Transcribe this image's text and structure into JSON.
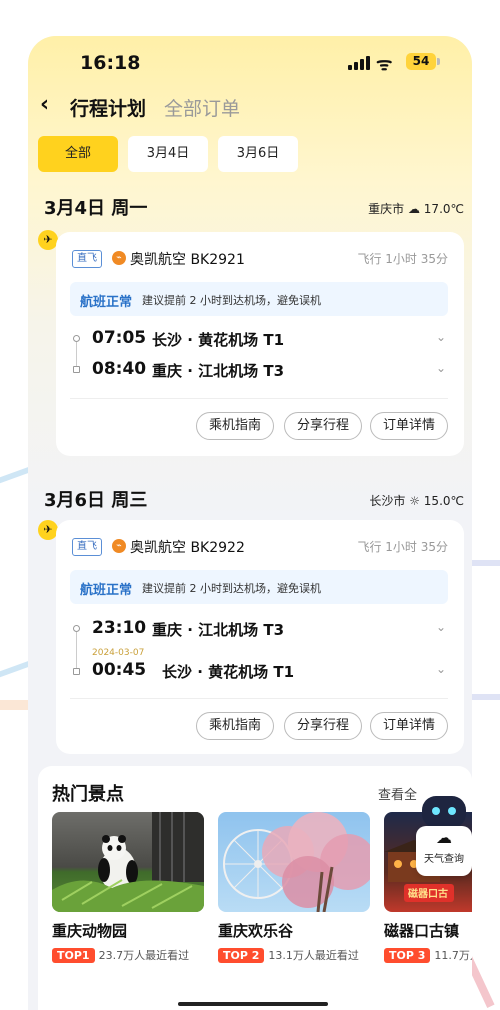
{
  "status": {
    "time": "16:18",
    "battery": "54"
  },
  "nav": {
    "back_icon": "chevron-left-icon",
    "title": "行程计划",
    "all_orders": "全部订单"
  },
  "filters": [
    "全部",
    "3月4日",
    "3月6日"
  ],
  "days": [
    {
      "title": "3月4日 周一",
      "weather": "重庆市 ☁ 17.0℃",
      "card": {
        "tag": "直飞",
        "flight": "奥凯航空 BK2921",
        "duration": "飞行 1小时 35分",
        "status": "航班正常",
        "notice": "建议提前 2 小时到达机场，避免误机",
        "dep_time": "07:05",
        "dep_place": "长沙 · 黄花机场 T1",
        "arr_time": "08:40",
        "arr_place": "重庆 · 江北机场 T3",
        "arr_date": "",
        "buttons": [
          "乘机指南",
          "分享行程",
          "订单详情"
        ]
      }
    },
    {
      "title": "3月6日 周三",
      "weather": "长沙市 ☼ 15.0℃",
      "card": {
        "tag": "直飞",
        "flight": "奥凯航空 BK2922",
        "duration": "飞行 1小时 35分",
        "status": "航班正常",
        "notice": "建议提前 2 小时到达机场，避免误机",
        "dep_time": "23:10",
        "dep_place": "重庆 · 江北机场 T3",
        "arr_time": "00:45",
        "arr_place": "长沙 · 黄花机场 T1",
        "arr_date": "2024-03-07",
        "buttons": [
          "乘机指南",
          "分享行程",
          "订单详情"
        ]
      }
    }
  ],
  "spots": {
    "title": "热门景点",
    "see_all": "查看全",
    "items": [
      {
        "name": "重庆动物园",
        "rank": "TOP1",
        "views": "23.7万人最近看过"
      },
      {
        "name": "重庆欢乐谷",
        "rank": "TOP 2",
        "views": "13.1万人最近看过"
      },
      {
        "name": "磁器口古镇",
        "rank": "TOP 3",
        "views": "11.7万人"
      }
    ],
    "img3_text": "磁器口古"
  },
  "widget": {
    "label": "天气查询"
  }
}
